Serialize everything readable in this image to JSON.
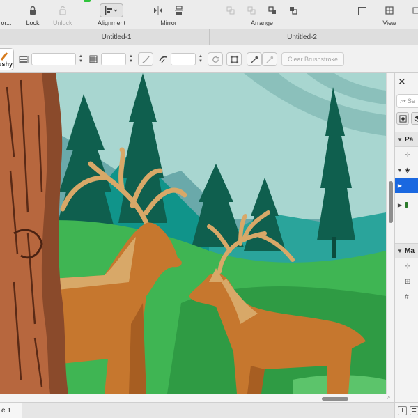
{
  "toolbar": {
    "clipped_label": "or...",
    "lock_label": "Lock",
    "unlock_label": "Unlock",
    "alignment_label": "Alignment",
    "mirror_label": "Mirror",
    "arrange_label": "Arrange",
    "view_label": "View"
  },
  "tabs": [
    {
      "label": "Untitled-1"
    },
    {
      "label": "Untitled-2"
    }
  ],
  "propbar": {
    "brush_label": "ushy",
    "width_value": "",
    "size_value": "",
    "angle_value": "",
    "clear_brushstroke_label": "Clear Brushstroke"
  },
  "status": {
    "page_label": "e 1"
  },
  "panel": {
    "close_glyph": "✕",
    "search_placeholder": "Se",
    "section1_label": "Pa",
    "section2_label": "Ma"
  },
  "colors": {
    "accent": "#1a68e0",
    "sky": "#a8d6d0",
    "mountain": "#6aa9aa",
    "pine": "#0f5f4e",
    "grass": "#3fb553",
    "deer": "#c6772e",
    "antler": "#d8a868"
  }
}
